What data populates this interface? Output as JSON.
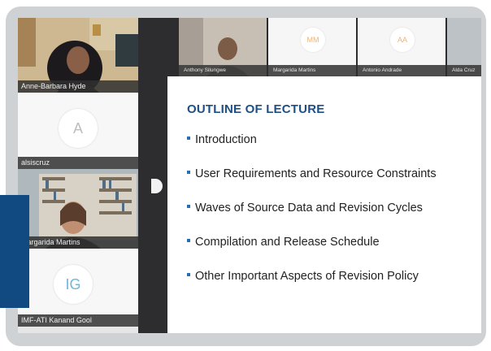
{
  "participants_left": [
    {
      "name": "Anne-Barbara Hyde",
      "type": "video"
    },
    {
      "name": "alsiscruz",
      "type": "avatar",
      "initial": "A"
    },
    {
      "name": "Margarida Martins",
      "type": "video"
    },
    {
      "name": "IMF-ATI Kanand Gool",
      "type": "avatar",
      "initial": "IG"
    }
  ],
  "participants_top": [
    {
      "name": "Anthony Silungwe",
      "type": "video"
    },
    {
      "name": "Margarida Martins",
      "type": "avatar",
      "initial": "MM"
    },
    {
      "name": "Antonio Andrade",
      "type": "avatar",
      "initial": "AA"
    },
    {
      "name": "Alda Cruz",
      "type": "video"
    }
  ],
  "slide": {
    "title": "OUTLINE OF LECTURE",
    "bullets": [
      "Introduction",
      "User Requirements and Resource Constraints",
      "Waves of Source Data and Revision Cycles",
      "Compilation and Release Schedule",
      "Other Important Aspects of Revision Policy"
    ]
  },
  "colors": {
    "slide_title": "#1d4f86",
    "bullet": "#2b6cb0",
    "avatar_initial_top": "#f2b36d",
    "avatar_initial_left": "#bdbdbd",
    "avatar_initial_ig": "#6fb8d8",
    "overlay_block": "#104a80"
  }
}
